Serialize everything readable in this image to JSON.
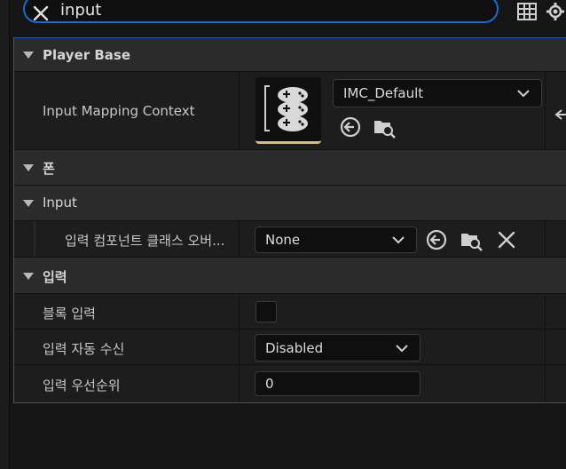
{
  "search": {
    "value": "input",
    "placeholder": ""
  },
  "icons": {
    "clear": "close-icon",
    "table": "table-view-icon",
    "settings": "gear-icon"
  },
  "colors": {
    "accent": "#1a6bd1",
    "thumb_underline": "#d9c36a"
  },
  "categories": {
    "player_base": {
      "label": "Player Base"
    },
    "pawn": {
      "label": "폰"
    },
    "input_sub": {
      "label": "Input"
    },
    "input_ko": {
      "label": "입력"
    }
  },
  "properties": {
    "input_mapping_context": {
      "label": "Input Mapping Context",
      "value": "IMC_Default"
    },
    "input_component_override": {
      "label": "입력 컴포넌트 클래스 오버...",
      "value": "None"
    },
    "block_input": {
      "label": "블록 입력",
      "checked": false
    },
    "auto_receive_input": {
      "label": "입력 자동 수신",
      "value": "Disabled"
    },
    "input_priority": {
      "label": "입력 우선순위",
      "value": "0"
    }
  }
}
